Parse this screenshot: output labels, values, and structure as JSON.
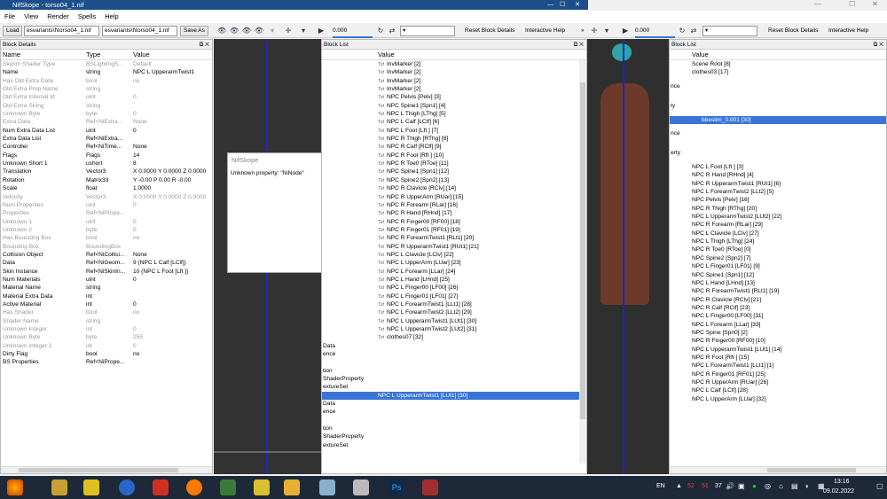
{
  "window": {
    "title": "NifSkope - torso04_1.nif"
  },
  "menu": [
    "File",
    "View",
    "Render",
    "Spells",
    "Help"
  ],
  "toolbar": {
    "load": "Load",
    "path1": "esvariants\\f\\torso04_1.nif",
    "path2": "esvariants\\f\\torso04_1.nif",
    "save_as": "Save As",
    "slider": "0.000",
    "reset": "Reset Block Details",
    "help": "Interactive Help",
    "slider2": "0.000",
    "reset2": "Reset Block Details",
    "help2": "Interactive Help"
  },
  "block_details": {
    "title": "Block Details",
    "cols": [
      "Name",
      "Type",
      "Value"
    ],
    "rows": [
      [
        "Skyrim Shader Type",
        "BSLightingS...",
        "Default",
        1
      ],
      [
        "Name",
        "string",
        "NPC L UpperarmTwist1",
        0
      ],
      [
        "Has Old Extra Data",
        "bool",
        "no",
        1
      ],
      [
        "Old Extra Prop Name",
        "string",
        "",
        1
      ],
      [
        "Old Extra Internal Id",
        "uint",
        "0",
        1
      ],
      [
        "Old Extra String",
        "string",
        "",
        1
      ],
      [
        "Unknown Byte",
        "byte",
        "0",
        1
      ],
      [
        "Extra Data",
        "Ref<NiExtra...",
        "None",
        1
      ],
      [
        "Num Extra Data List",
        "uint",
        "0",
        0
      ],
      [
        "Extra Data List",
        "Ref<NiExtra...",
        "",
        0
      ],
      [
        "Controller",
        "Ref<NiTime...",
        "None",
        0
      ],
      [
        "Flags",
        "Flags",
        "14",
        0
      ],
      [
        "Unknown Short 1",
        "ushort",
        "8",
        0
      ],
      [
        "Translation",
        "Vector3",
        "X 0.0000 Y 0.0000 Z 0.0000",
        0
      ],
      [
        "Rotation",
        "Matrix33",
        "Y -0.00 P 0.00 R -0.00",
        0
      ],
      [
        "Scale",
        "float",
        "1.0000",
        0
      ],
      [
        "Velocity",
        "Vector3",
        "X 0.0000 Y 0.0000 Z 0.0000",
        1
      ],
      [
        "Num Properties",
        "uint",
        "0",
        1
      ],
      [
        "Properties",
        "Ref<NiPrope...",
        "",
        1
      ],
      [
        "Unknown 1",
        "uint",
        "0",
        1
      ],
      [
        "Unknown 2",
        "byte",
        "0",
        1
      ],
      [
        "Has Bounding Box",
        "bool",
        "no",
        1
      ],
      [
        "Bounding Box",
        "BoundingBox",
        "",
        1
      ],
      [
        "Collision Object",
        "Ref<NiCollisi...",
        "None",
        0
      ],
      [
        "Data",
        "Ref<NiGeom...",
        "9 (NPC L Calf [LClf])",
        0
      ],
      [
        "Skin Instance",
        "Ref<NiSkinIn...",
        "10 (NPC L Foot [Lft ])",
        0
      ],
      [
        "Num Materials",
        "uint",
        "0",
        0
      ],
      [
        "Material Name",
        "string",
        "",
        0
      ],
      [
        "Material Extra Data",
        "int",
        "",
        0
      ],
      [
        "Active Material",
        "int",
        "0",
        0
      ],
      [
        "Has Shader",
        "bool",
        "no",
        1
      ],
      [
        "Shader Name",
        "string",
        "",
        1
      ],
      [
        "Unknown Integer",
        "int",
        "0",
        1
      ],
      [
        "Unknown Byte",
        "byte",
        "255",
        1
      ],
      [
        "Unknown Integer 2",
        "int",
        "0",
        1
      ],
      [
        "Dirty Flag",
        "bool",
        "no",
        0
      ],
      [
        "BS Properties",
        "Ref<NiPrope...",
        "",
        0
      ]
    ]
  },
  "block_list": {
    "title": "Block List",
    "col": "Value",
    "rows": [
      "InvMarker [2]",
      "InvMarker [2]",
      "InvMarker [2]",
      "InvMarker [2]",
      "NPC Pelvis [Pelv] [3]",
      "NPC Spine1 [Spn1] [4]",
      "NPC L Thigh [LThg] [5]",
      "NPC L Calf [LClf] [6]",
      "NPC L Foot [Lft ] [7]",
      "NPC R Thigh [RThg] [8]",
      "NPC R Calf [RClf] [9]",
      "NPC R Foot [Rft ] [10]",
      "NPC R Toe0 [RToe] [11]",
      "NPC Spine1 [Spn1] [12]",
      "NPC Spine2 [Spn2] [13]",
      "NPC R Clavicle [RClv] [14]",
      "NPC R UpperArm [RUar] [15]",
      "NPC R Forearm [RLar] [16]",
      "NPC R Hand [RHnd] [17]",
      "NPC R Finger00 [RF00] [18]",
      "NPC R Finger01 [RF01] [19]",
      "NPC R ForearmTwist1 [RLt1] [20]",
      "NPC R UpperarmTwist1 [RUt1] [21]",
      "NPC L Clavicle [LClv] [22]",
      "NPC L UpperArm [LUar] [23]",
      "NPC L Forearm [LLar] [24]",
      "NPC L Hand [LHnd] [25]",
      "NPC L Finger00 [LF00] [26]",
      "NPC L Finger01 [LF01] [27]",
      "NPC L ForearmTwist1 [LLt1] [28]",
      "NPC L ForearmTwist2 [LLt2] [29]",
      "NPC L UpperarmTwist1 [LUt1] [30]",
      "NPC L UpperarmTwist2 [LUt2] [31]",
      "clothes07 [32]"
    ],
    "lower": [
      "Data",
      "ence",
      "",
      "tion",
      "ShaderProperty",
      "extureSet",
      "",
      "Data",
      "ence",
      "",
      "tion",
      "ShaderProperty",
      "extureSet"
    ],
    "selected": "NPC L UpperarmTwist1 [LUt1] [30]"
  },
  "dialog": {
    "title": "NifSkope",
    "message": "Unknown property: \"NiNode\""
  },
  "right_list": {
    "title": "Block List",
    "col": "Value",
    "top": [
      "Scene Root [8]",
      "clothes03 [17]"
    ],
    "labels": [
      "nce",
      "ty",
      "nce",
      "erty"
    ],
    "selected": "bbeslim_0.001 [30]",
    "rows": [
      "NPC L Foot [Lft ] [3]",
      "NPC R Hand [RHnd] [4]",
      "NPC R UpperarmTwist1 [RUt1] [6]",
      "NPC L ForearmTwist2 [LLt2] [5]",
      "NPC Pelvis [Pelv] [16]",
      "NPC R Thigh [RThg] [20]",
      "NPC L UpperarmTwist2 [LUt2] [22]",
      "NPC R Forearm [RLar] [29]",
      "NPC L Clavicle [LClv] [27]",
      "NPC L Thigh [LThg] [24]",
      "NPC R Toe0 [RToe] [0]",
      "NPC Spine2 [Spn2] [7]",
      "NPC L Finger01 [LF01] [9]",
      "NPC Spine1 [Spn1] [12]",
      "NPC L Hand [LHnd] [13]",
      "NPC R ForearmTwist1 [RLt1] [19]",
      "NPC R Clavicle [RClv] [21]",
      "NPC R Calf [RClf] [23]",
      "NPC L Finger00 [LF00] [31]",
      "NPC L Forearm [LLar] [33]",
      "NPC Spine [Spn0] [2]",
      "NPC R Finger00 [RF00] [10]",
      "NPC L UpperarmTwist1 [LUt1] [14]",
      "NPC R Foot [Rft ] [15]",
      "NPC L ForearmTwist1 [LLt1] [1]",
      "NPC R Finger01 [RF01] [25]",
      "NPC R UpperArm [RUar] [26]",
      "NPC L Calf [LClf] [28]",
      "NPC L UpperArm [LUar] [32]"
    ]
  },
  "taskbar": {
    "lang": "EN",
    "time": "13:16",
    "date": "09.02.2022",
    "temps": [
      "52",
      "51",
      "37"
    ]
  }
}
